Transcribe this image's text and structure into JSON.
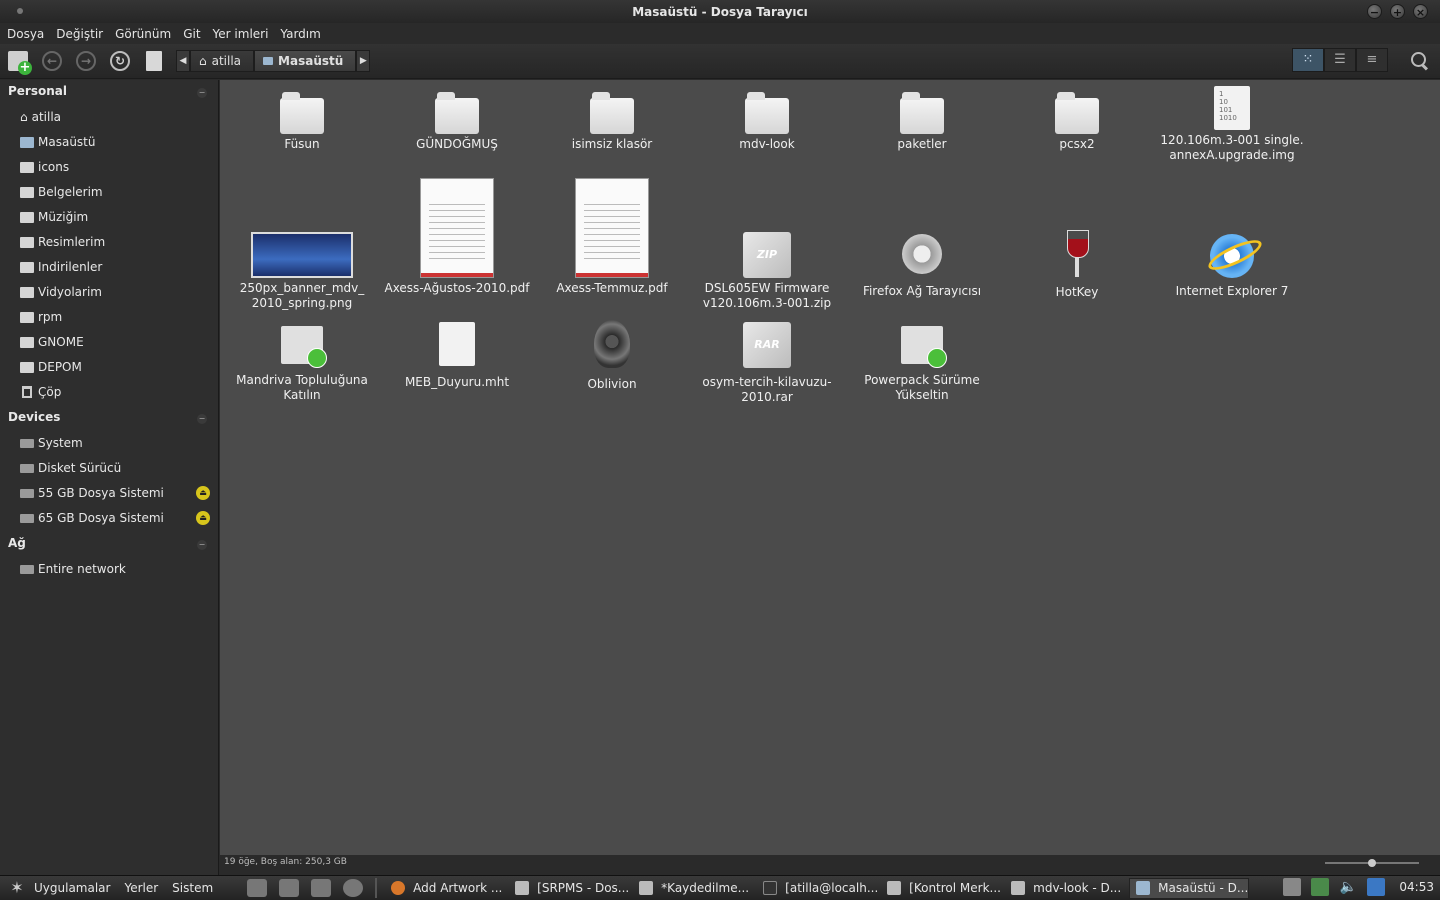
{
  "window": {
    "title": "Masaüstü - Dosya Tarayıcı"
  },
  "menubar": [
    "Dosya",
    "Değiştir",
    "Görünüm",
    "Git",
    "Yer imleri",
    "Yardım"
  ],
  "pathbar": {
    "home": "atilla",
    "current": "Masaüstü"
  },
  "sidebar": {
    "personal_title": "Personal",
    "personal": [
      "atilla",
      "Masaüstü",
      "icons",
      "Belgelerim",
      "Müziğim",
      "Resimlerim",
      "Indirilenler",
      "Vidyolarim",
      "rpm",
      "GNOME",
      "DEPOM",
      "Çöp"
    ],
    "devices_title": "Devices",
    "devices": [
      "System",
      "Disket Sürücü",
      "55 GB Dosya Sistemi",
      "65 GB Dosya Sistemi"
    ],
    "network_title": "Ağ",
    "network": [
      "Entire network"
    ]
  },
  "files": [
    {
      "name": "Füsun",
      "type": "folder"
    },
    {
      "name": "GÜNDOĞMUŞ",
      "type": "folder"
    },
    {
      "name": "isimsiz klasör",
      "type": "folder"
    },
    {
      "name": "mdv-look",
      "type": "folder"
    },
    {
      "name": "paketler",
      "type": "folder"
    },
    {
      "name": "pcsx2",
      "type": "folder"
    },
    {
      "name": "120.106m.3-001 single.\nannexA.upgrade.img",
      "type": "binary"
    },
    {
      "name": "250px_banner_mdv_\n2010_spring.png",
      "type": "image"
    },
    {
      "name": "Axess-Ağustos-2010.pdf",
      "type": "pdf"
    },
    {
      "name": "Axess-Temmuz.pdf",
      "type": "pdf"
    },
    {
      "name": "DSL605EW Firmware\nv120.106m.3-001.zip",
      "type": "zip"
    },
    {
      "name": "Firefox Ağ Tarayıcısı",
      "type": "firefox"
    },
    {
      "name": "HotKey",
      "type": "wine"
    },
    {
      "name": "Internet Explorer 7",
      "type": "ie"
    },
    {
      "name": "Mandriva Topluluğuna\nKatılın",
      "type": "shortcut"
    },
    {
      "name": "MEB_Duyuru.mht",
      "type": "text"
    },
    {
      "name": "Oblivion",
      "type": "oblivion"
    },
    {
      "name": "osym-tercih-kilavuzu-\n2010.rar",
      "type": "rar"
    },
    {
      "name": "Powerpack Sürüme\nYükseltin",
      "type": "shortcut"
    }
  ],
  "binary_icon_text": "1\n10\n101\n1010",
  "zip_label": "ZIP",
  "rar_label": "RAR",
  "status": "19 öğe, Boş alan: 250,3 GB",
  "panel": {
    "menus": [
      "Uygulamalar",
      "Yerler",
      "Sistem"
    ],
    "tasks": [
      "Add Artwork ...",
      "[SRPMS - Dos...",
      "*Kaydedilme...",
      "[atilla@localh...",
      "[Kontrol Merk...",
      "mdv-look - D...",
      "Masaüstü - D..."
    ],
    "clock": "04:53"
  }
}
